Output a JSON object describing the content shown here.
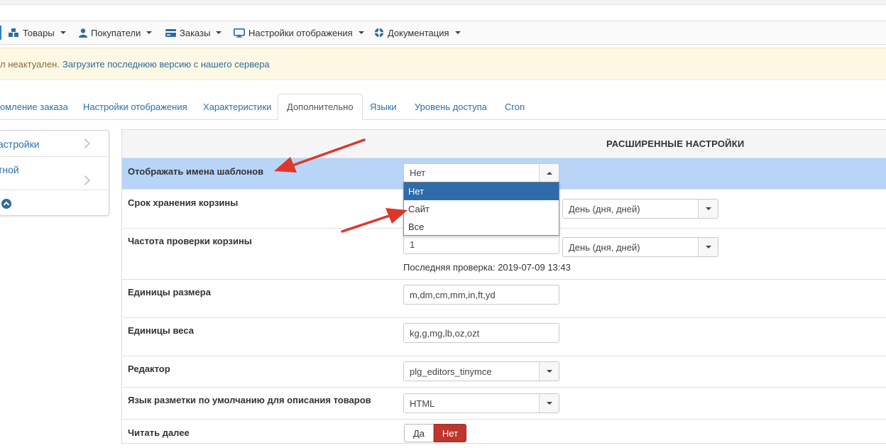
{
  "menu": {
    "items": [
      {
        "label": "Товары",
        "icon": "cubes-icon"
      },
      {
        "label": "Покупатели",
        "icon": "user-icon"
      },
      {
        "label": "Заказы",
        "icon": "credit-card-icon"
      },
      {
        "label": "Настройки отображения",
        "icon": "monitor-icon"
      },
      {
        "label": "Документация",
        "icon": "lifebuoy-icon"
      }
    ]
  },
  "alert": {
    "text": "л неактуален.",
    "link": "Загрузите последнюю версию с нашего сервера"
  },
  "tabs": [
    "омление заказа",
    "Настройки отображения",
    "Характеристики",
    "Дополнительно",
    "Языки",
    "Уровень доступа",
    "Cron"
  ],
  "sidebar": {
    "items": [
      "астройки",
      "тной"
    ]
  },
  "settings": {
    "title": "РАСШИРЕННЫЕ НАСТРОЙКИ",
    "rows": {
      "show_template_names": {
        "label": "Отображать имена шаблонов",
        "value": "Нет",
        "options": [
          "Нет",
          "Сайт",
          "Все"
        ]
      },
      "cart_storage": {
        "label": "Срок хранения корзины",
        "unit": "День (дня, дней)"
      },
      "cart_check": {
        "label": "Частота проверки корзины",
        "value": "1",
        "unit": "День (дня, дней)",
        "note": "Последняя проверка: 2019-07-09 13:43"
      },
      "size_units": {
        "label": "Единицы размера",
        "value": "m,dm,cm,mm,in,ft,yd"
      },
      "weight_units": {
        "label": "Единицы веса",
        "value": "kg,g,mg,lb,oz,ozt"
      },
      "editor": {
        "label": "Редактор",
        "value": "plg_editors_tinymce"
      },
      "markup_lang": {
        "label": "Язык разметки по умолчанию для описания товаров",
        "value": "HTML"
      },
      "read_more": {
        "label": "Читать далее",
        "yes": "Да",
        "no": "Нет"
      }
    }
  },
  "colors": {
    "highlight_row": "#b8d4f7",
    "selected_option": "#2f6ba9",
    "no_button": "#bd362f",
    "annotation_arrow": "#e0352b"
  }
}
